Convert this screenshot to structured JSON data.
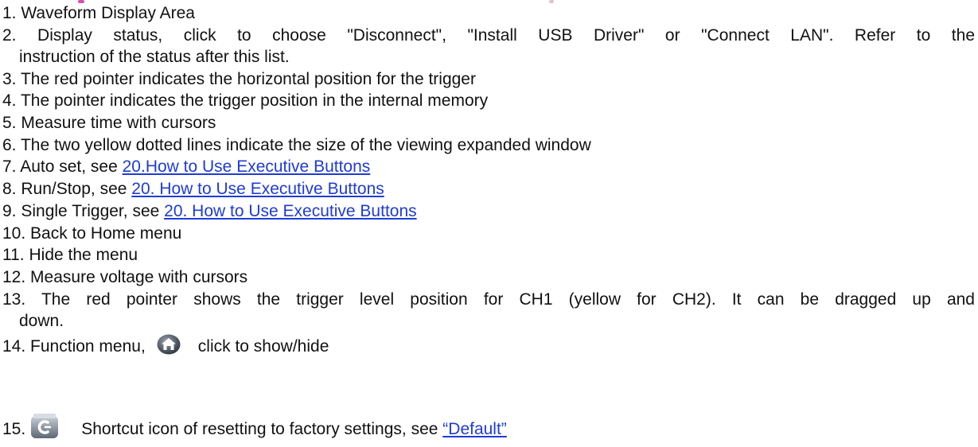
{
  "items": [
    {
      "num": "1.",
      "text": "Waveform Display Area"
    },
    {
      "num": "2.",
      "text": "Display status, click to choose \"Disconnect\", \"Install USB Driver\" or \"Connect LAN\". Refer to the",
      "cont": "instruction of the status after this list."
    },
    {
      "num": "3.",
      "text": "The red pointer indicates the horizontal position for the trigger"
    },
    {
      "num": "4.",
      "text": "The pointer indicates the trigger position in the internal memory"
    },
    {
      "num": "5.",
      "text": "Measure time with cursors"
    },
    {
      "num": "6.",
      "text": "The two yellow dotted lines indicate the size of the viewing expanded window"
    },
    {
      "num": "7.",
      "text": "Auto set, see",
      "link": "20.How to Use Executive Buttons"
    },
    {
      "num": "8.",
      "text": "Run/Stop, see",
      "link": "20. How to Use Executive Buttons"
    },
    {
      "num": "9.",
      "text": "Single Trigger, see",
      "link": "20. How to Use Executive Buttons"
    },
    {
      "num": "10.",
      "text": "Back to Home menu"
    },
    {
      "num": "11.",
      "text": "Hide the menu"
    },
    {
      "num": "12.",
      "text": "Measure voltage with cursors"
    },
    {
      "num": "13.",
      "text": "The red pointer shows the trigger level position for CH1 (yellow for CH2). It can be dragged up and",
      "cont": "down."
    },
    {
      "num": "14.",
      "text": "Function menu,",
      "after": "click to show/hide",
      "icon": "home-icon"
    },
    {
      "num": "15.",
      "text": "Shortcut icon of resetting to factory settings, see",
      "link": "“Default”",
      "icon": "factory-default-icon"
    }
  ],
  "colors": {
    "link": "#1f3bd6",
    "text": "#111111"
  }
}
